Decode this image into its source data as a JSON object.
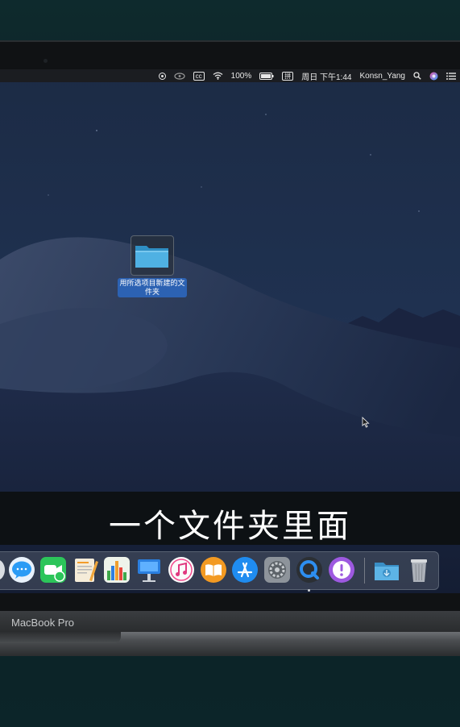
{
  "menubar": {
    "battery": "100%",
    "input_method": "拼",
    "datetime": "周日 下午1:44",
    "username": "Konsn_Yang"
  },
  "desktop": {
    "folder_label": "用所选项目新建的文件夹"
  },
  "subtitle": "一个文件夹里面",
  "laptop": {
    "model": "MacBook Pro"
  },
  "dock": {
    "apps": [
      "messages-icon",
      "facetime-icon",
      "pages-icon",
      "numbers-icon",
      "keynote-icon",
      "itunes-icon",
      "ibooks-icon",
      "app-store-icon",
      "system-preferences-icon",
      "quicktime-icon",
      "feedback-icon",
      "downloads-folder-icon",
      "trash-icon"
    ]
  },
  "colors": {
    "selection": "#2c62b3",
    "desktop": "#1f3150"
  }
}
